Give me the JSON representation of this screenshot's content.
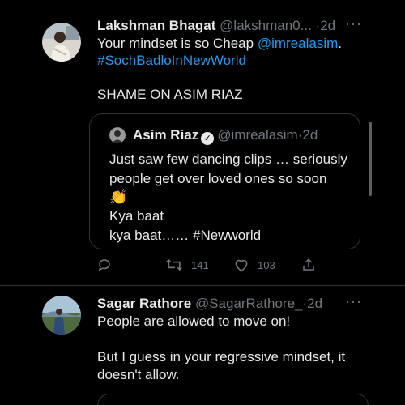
{
  "tweets": [
    {
      "name": "Lakshman Bhagat",
      "handle": "@lakshman0...",
      "dot": "·",
      "time": "2d",
      "more": "···",
      "text_line1_pre": "Your mindset is so Cheap ",
      "mention": "@imrealasim",
      "text_line1_post": ".",
      "hashtag": "#SochBadloInNewWorld",
      "text_line3": "SHAME ON ASIM RIAZ",
      "quote": {
        "name": "Asim Riaz",
        "verified": "✓",
        "handle": "@imrealasim",
        "dot": "·",
        "time": "2d",
        "line1": "Just saw few dancing clips … seriously",
        "line2": "people get over loved ones so soon",
        "emoji": "👏",
        "line3": "Kya baat",
        "line4": "kya baat…… #Newworld"
      },
      "actions": {
        "reply_count": "",
        "retweet_count": "141",
        "like_count": "103"
      }
    },
    {
      "name": "Sagar Rathore",
      "handle": "@SagarRathore_",
      "dot": "·",
      "time": "2d",
      "more": "···",
      "line1": "People are allowed to move on!",
      "line2": "But I guess in your regressive mindset, it",
      "line3": "doesn't allow."
    }
  ],
  "colors": {
    "background": "#000000",
    "text": "#e7e9ea",
    "muted": "#71767b",
    "link": "#1d9bf0",
    "border": "#2f3336"
  },
  "icons": [
    "reply-icon",
    "retweet-icon",
    "like-icon",
    "share-icon",
    "verified-icon",
    "more-icon"
  ]
}
